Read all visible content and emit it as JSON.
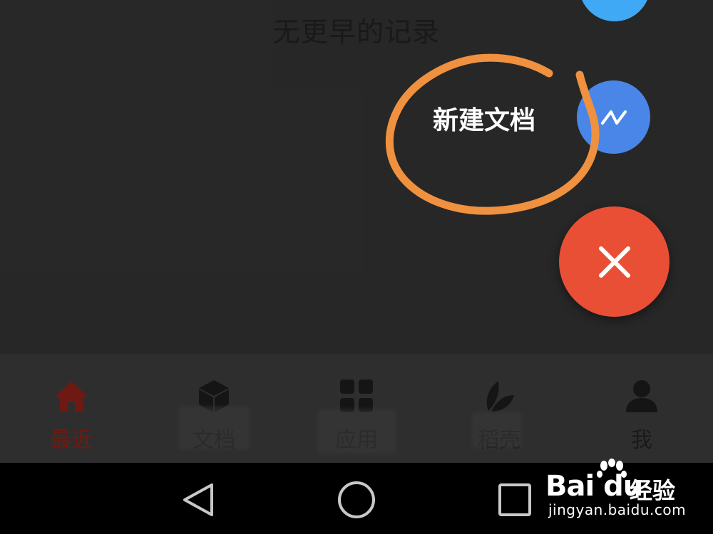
{
  "main": {
    "empty_message": "无更早的记录"
  },
  "fab_menu": {
    "new_document_label": "新建文档",
    "colors": {
      "top_fab": "#3fa9f5",
      "doc_fab": "#4a86e8",
      "close_fab": "#e94f35",
      "annotation": "#f0913f"
    }
  },
  "tabs": [
    {
      "label": "最近",
      "icon": "home-icon",
      "active": true
    },
    {
      "label": "文档",
      "icon": "cube-icon",
      "active": false
    },
    {
      "label": "应用",
      "icon": "grid-icon",
      "active": false
    },
    {
      "label": "稻壳",
      "icon": "leaf-icon",
      "active": false
    },
    {
      "label": "我",
      "icon": "user-icon",
      "active": false
    }
  ],
  "system_nav": {
    "buttons": [
      "back-icon",
      "home-circle-icon",
      "recents-icon"
    ]
  },
  "watermark": {
    "brand_text": "Bai du",
    "brand_cn": "经验",
    "url": "jingyan.baidu.com"
  }
}
